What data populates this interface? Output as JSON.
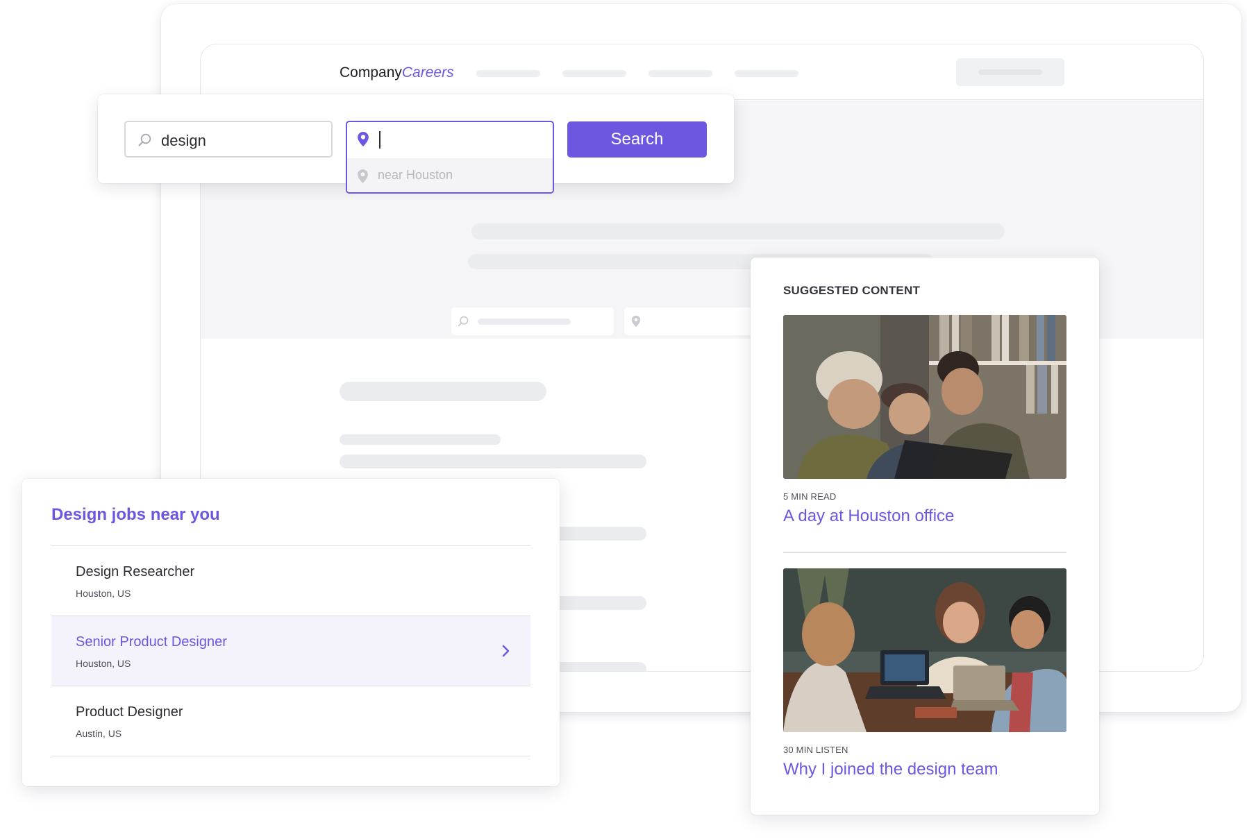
{
  "brand": {
    "company": "Company",
    "careers": "Careers",
    "accent_color": "#6e57e0"
  },
  "search": {
    "keyword_value": "design",
    "location_value": "",
    "location_suggestion": "near Houston",
    "button_label": "Search"
  },
  "jobs": {
    "title": "Design jobs near you",
    "items": [
      {
        "title": "Design Researcher",
        "location": "Houston, US"
      },
      {
        "title": "Senior Product Designer",
        "location": "Houston, US"
      },
      {
        "title": "Product Designer",
        "location": "Austin, US"
      }
    ]
  },
  "suggested": {
    "heading": "SUGGESTED CONTENT",
    "articles": [
      {
        "meta": "5 MIN READ",
        "title": "A day at Houston office"
      },
      {
        "meta": "30 MIN LISTEN",
        "title": "Why I joined the design team"
      }
    ]
  },
  "icons": {
    "search": "search-icon",
    "location": "location-pin-icon",
    "chevron": "chevron-right-icon"
  }
}
